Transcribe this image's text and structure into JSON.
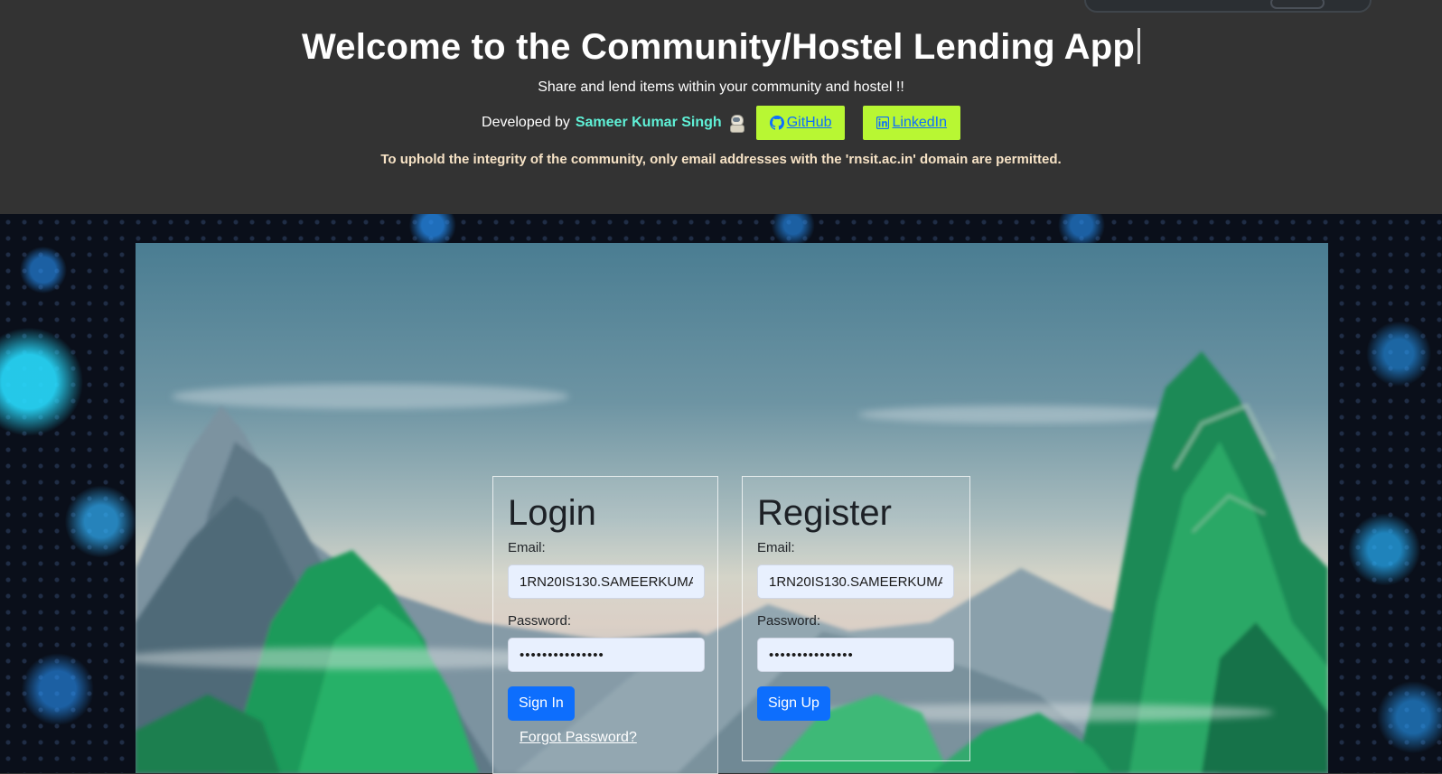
{
  "header": {
    "title": "Welcome to the Community/Hostel Lending App",
    "subtitle": "Share and lend items within your community and hostel !!",
    "developed_by_label": "Developed by",
    "developer_name": "Sameer Kumar Singh",
    "github_label": " GitHub ",
    "linkedin_label": " LinkedIn",
    "notice": "To uphold the integrity of the community, only email addresses with the 'rnsit.ac.in' domain are permitted."
  },
  "login": {
    "title": "Login",
    "email_label": "Email:",
    "email_value": "1RN20IS130.SAMEERKUMA",
    "password_label": "Password:",
    "password_value": "•••••••••••••••",
    "submit_label": "Sign In",
    "forgot_label": "Forgot Password?"
  },
  "register": {
    "title": "Register",
    "email_label": "Email:",
    "email_value": "1RN20IS130.SAMEERKUMA",
    "password_label": "Password:",
    "password_value": "•••••••••••••••",
    "submit_label": "Sign Up"
  },
  "icons": {
    "developer": "astronaut-icon",
    "github": "github-icon",
    "linkedin": "linkedin-icon"
  },
  "colors": {
    "header_bg": "#333333",
    "developer_name": "#5ff0d6",
    "link_button_bg": "#b8f733",
    "link_text": "#0d6efd",
    "notice_text": "#f7e3c6",
    "primary_button": "#0d6efd"
  }
}
